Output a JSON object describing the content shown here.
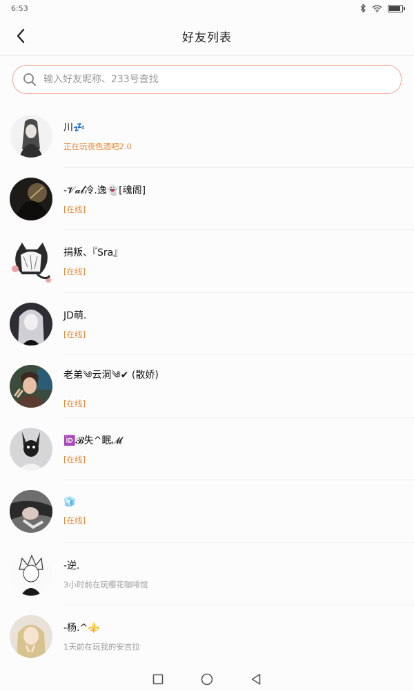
{
  "status_bar": {
    "time": "6:53"
  },
  "header": {
    "title": "好友列表"
  },
  "search": {
    "placeholder": "输入好友昵称、233号查找"
  },
  "friends": [
    {
      "name": "川💤",
      "status": "正在玩夜色酒吧2.0",
      "status_color": "#e88b3a"
    },
    {
      "name": "-𝓥𝓪𝓵冷.逸👻[魂阁]",
      "status": "[在线]",
      "status_color": "#e88b3a"
    },
    {
      "name": "捐叛、『Sra』",
      "status": "[在线]",
      "status_color": "#e88b3a"
    },
    {
      "name": "JD萌.",
      "status": "[在线]",
      "status_color": "#e88b3a"
    },
    {
      "name": "老弟༄云洞༄✔ (散娇)",
      "status": "[在线]",
      "status_color": "#e88b3a"
    },
    {
      "name": "🆔𝓑失^眠𝓜",
      "status": "[在线]",
      "status_color": "#e88b3a"
    },
    {
      "name": "🧊",
      "status": "[在线]",
      "status_color": "#e88b3a"
    },
    {
      "name": "-逆.",
      "status": "3小时前在玩樱花咖啡馆",
      "status_color": "#9e9e9e"
    },
    {
      "name": "-杨.^⚜️",
      "status": "1天前在玩我的安吉拉",
      "status_color": "#9e9e9e"
    }
  ],
  "colors": {
    "accent_orange": "#e88b3a",
    "search_border": "#f1a795",
    "muted_text": "#9e9e9e"
  },
  "icons": {
    "back": "chevron-left-icon",
    "search": "search-icon",
    "nav_square": "recent-apps-icon",
    "nav_circle": "home-icon",
    "nav_triangle": "back-triangle-icon"
  }
}
